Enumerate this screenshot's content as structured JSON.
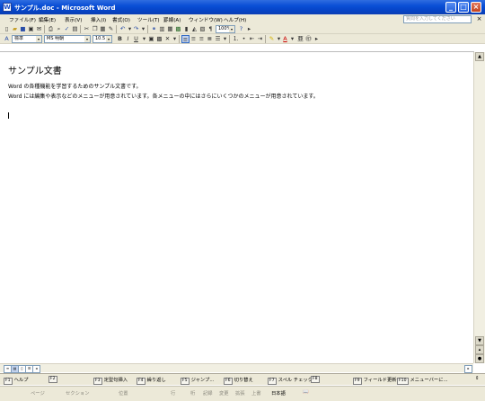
{
  "window": {
    "title": "サンプル.doc - Microsoft Word",
    "app_icon": "W"
  },
  "menu": {
    "items": [
      "ファイル(F)",
      "編集(E)",
      "表示(V)",
      "挿入(I)",
      "書式(O)",
      "ツール(T)",
      "罫線(A)",
      "ウィンドウ(W)",
      "ヘルプ(H)"
    ],
    "help_search_placeholder": "質問を入力してください",
    "help_close": "×"
  },
  "toolbar_standard": {
    "zoom": "100%"
  },
  "toolbar_format": {
    "style": "標準",
    "font": "MS 明朝",
    "size": "10.5",
    "bold": "B",
    "italic": "I",
    "underline": "U"
  },
  "document": {
    "title": "サンプル文書",
    "lines": [
      "Word の各種機能を学習するためのサンプル文書です。",
      "Word には編集や表示などのメニューが用意されています。各メニューの中にはさらにいくつかのメニューが用意されています。"
    ]
  },
  "fkeys": [
    {
      "num": "F1",
      "label": "ヘルプ"
    },
    {
      "num": "F2",
      "label": ""
    },
    {
      "num": "F3",
      "label": "定型句挿入"
    },
    {
      "num": "F4",
      "label": "繰り返し"
    },
    {
      "num": "F5",
      "label": "ジャンプ..."
    },
    {
      "num": "F6",
      "label": "切り替え"
    },
    {
      "num": "F7",
      "label": "スペル チェック..."
    },
    {
      "num": "F8",
      "label": ""
    },
    {
      "num": "F9",
      "label": "フィールド更新"
    },
    {
      "num": "F10",
      "label": "メニューバーに..."
    }
  ],
  "status": {
    "page": "ページ",
    "section": "セクション",
    "position": "位置",
    "line": "行",
    "column": "桁",
    "rec": "記録",
    "trk": "変更",
    "ext": "拡張",
    "ovr": "上書",
    "language": "日本語"
  }
}
